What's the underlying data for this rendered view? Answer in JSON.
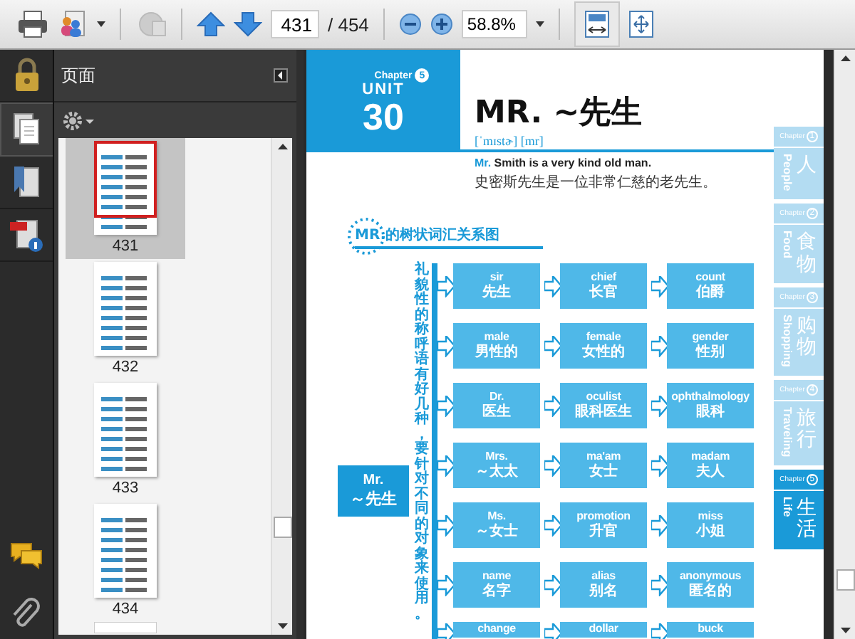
{
  "toolbar": {
    "page_number": "431",
    "page_total": "/ 454",
    "zoom": "58.8%"
  },
  "nav_tools": [
    {
      "kind": "lock",
      "selected": false
    },
    {
      "kind": "pages",
      "selected": true
    },
    {
      "kind": "bookmarks",
      "selected": false
    },
    {
      "kind": "properties",
      "selected": false
    }
  ],
  "nav_bottom_tools": [
    {
      "kind": "comments"
    },
    {
      "kind": "attachments"
    }
  ],
  "panel": {
    "title": "页面"
  },
  "thumbnails": [
    {
      "label": "431",
      "selected": true
    },
    {
      "label": "432",
      "selected": false
    },
    {
      "label": "433",
      "selected": false
    },
    {
      "label": "434",
      "selected": false
    }
  ],
  "page": {
    "chapter": "Chapter",
    "chapter_number": "5",
    "unit": "UNIT",
    "unit_number": "30",
    "title": "MR. ~先生",
    "pronunciation": "[ˈmɪstɚ]  [mr]",
    "example_keyword": "Mr.",
    "example_en": "Smith is a very kind old man.",
    "example_zh": "史密斯先生是一位非常仁慈的老先生。",
    "section_title": "MR.的树状词汇关系图",
    "root": {
      "english": "Mr.",
      "chinese": "～先生"
    },
    "note": "礼貌性的称呼语有好几种，要针对不同的对象来使用。",
    "rows": [
      [
        {
          "english": "sir",
          "chinese": "先生"
        },
        {
          "english": "chief",
          "chinese": "长官"
        },
        {
          "english": "count",
          "chinese": "伯爵"
        }
      ],
      [
        {
          "english": "male",
          "chinese": "男性的"
        },
        {
          "english": "female",
          "chinese": "女性的"
        },
        {
          "english": "gender",
          "chinese": "性别"
        }
      ],
      [
        {
          "english": "Dr.",
          "chinese": "医生"
        },
        {
          "english": "oculist",
          "chinese": "眼科医生"
        },
        {
          "english": "ophthalmology",
          "chinese": "眼科"
        }
      ],
      [
        {
          "english": "Mrs.",
          "chinese": "～太太"
        },
        {
          "english": "ma'am",
          "chinese": "女士"
        },
        {
          "english": "madam",
          "chinese": "夫人"
        }
      ],
      [
        {
          "english": "Ms.",
          "chinese": "～女士"
        },
        {
          "english": "promotion",
          "chinese": "升官"
        },
        {
          "english": "miss",
          "chinese": "小姐"
        }
      ],
      [
        {
          "english": "name",
          "chinese": "名字"
        },
        {
          "english": "alias",
          "chinese": "别名"
        },
        {
          "english": "anonymous",
          "chinese": "匿名的"
        }
      ],
      [
        {
          "english": "change"
        },
        {
          "english": "dollar"
        },
        {
          "english": "buck"
        }
      ]
    ],
    "chapter_tabs": [
      {
        "chapter": "Chapter",
        "number": "1",
        "english": "People",
        "chinese": "人",
        "selected": false
      },
      {
        "chapter": "Chapter",
        "number": "2",
        "english": "Food",
        "chinese": "食物",
        "selected": false
      },
      {
        "chapter": "Chapter",
        "number": "3",
        "english": "Shopping",
        "chinese": "购物",
        "selected": false
      },
      {
        "chapter": "Chapter",
        "number": "4",
        "english": "Traveling",
        "chinese": "旅行",
        "selected": false
      },
      {
        "chapter": "Chapter",
        "number": "5",
        "english": "Life",
        "chinese": "生活",
        "selected": true
      }
    ]
  }
}
